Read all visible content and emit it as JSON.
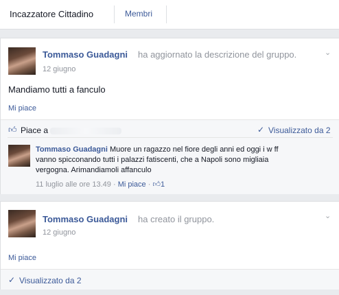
{
  "header": {
    "group_name": "Incazzatore Cittadino",
    "members_tab": "Membri"
  },
  "posts": [
    {
      "author": "Tommaso Guadagni",
      "action": "ha aggiornato la descrizione del gruppo.",
      "date": "12 giugno",
      "text": "Mandiamo tutti a fanculo",
      "like_link": "Mi piace",
      "likes_prefix": "Piace a",
      "seen": "Visualizzato da 2",
      "comment": {
        "author": "Tommaso Guadagni",
        "text_line1": "Muore un ragazzo nel fiore degli anni ed oggi i w ff",
        "text_line2": "vanno spicconando tutti i palazzi fatiscenti, che a Napoli sono migliaia",
        "text_line3": "vergogna. Arimandiamoli affanculo",
        "timestamp": "11 luglio alle ore 13.49",
        "separator": "·",
        "like_link": "Mi piace",
        "like_count": "1"
      }
    },
    {
      "author": "Tommaso Guadagni",
      "action": "ha creato il gruppo.",
      "date": "12 giugno",
      "like_link": "Mi piace",
      "seen": "Visualizzato da 2"
    }
  ],
  "icons": {
    "chevron": "chevron-down-icon",
    "thumb": "thumbs-up-icon",
    "check": "checkmark-icon"
  }
}
